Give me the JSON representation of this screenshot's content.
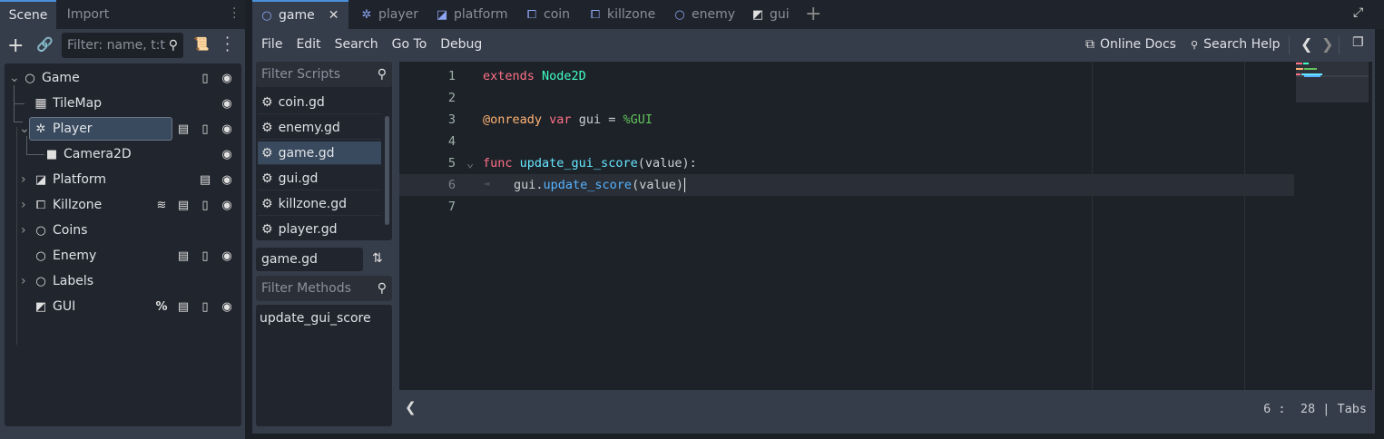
{
  "scene_dock": {
    "tabs": [
      "Scene",
      "Import"
    ],
    "filter_placeholder": "Filter: name, t:t",
    "tree": [
      {
        "name": "Game",
        "icon": "node2d-circle-icon"
      },
      {
        "name": "TileMap",
        "icon": "tilemap-icon"
      },
      {
        "name": "Player",
        "icon": "character-body-icon",
        "selected": true
      },
      {
        "name": "Camera2D",
        "icon": "camera-icon"
      },
      {
        "name": "Platform",
        "icon": "animatable-body-icon"
      },
      {
        "name": "Killzone",
        "icon": "area2d-icon"
      },
      {
        "name": "Coins",
        "icon": "node-circle-icon"
      },
      {
        "name": "Enemy",
        "icon": "node2d-circle-icon"
      },
      {
        "name": "Labels",
        "icon": "node-circle-icon"
      },
      {
        "name": "GUI",
        "icon": "canvas-layer-icon"
      }
    ]
  },
  "script_tabs": [
    "game",
    "player",
    "platform",
    "coin",
    "killzone",
    "enemy",
    "gui"
  ],
  "menu": [
    "File",
    "Edit",
    "Search",
    "Go To",
    "Debug"
  ],
  "toolbar": {
    "online_docs": "Online Docs",
    "search_help": "Search Help"
  },
  "scripts": {
    "filter_placeholder": "Filter Scripts",
    "items": [
      "coin.gd",
      "enemy.gd",
      "game.gd",
      "gui.gd",
      "killzone.gd",
      "player.gd"
    ],
    "selected": "game.gd",
    "current": "game.gd",
    "methods_placeholder": "Filter Methods",
    "methods": [
      "update_gui_score"
    ]
  },
  "editor": {
    "line_numbers": [
      "1",
      "2",
      "3",
      "4",
      "5",
      "6",
      "7"
    ],
    "tokens": {
      "l1a": "extends",
      "l1b": "Node2D",
      "l3a": "@onready",
      "l3b": "var",
      "l3c": "gui =",
      "l3d": "%GUI",
      "l5a": "func",
      "l5b": "update_gui_score",
      "l5c": "(value):",
      "l6a": "gui.",
      "l6b": "update_score",
      "l6c": "(value)"
    },
    "status": {
      "line": "6",
      "sep": ":",
      "col": "28",
      "indent": "Tabs"
    }
  },
  "colors": {
    "accent": "#4a8fd8",
    "selection": "#394a5e",
    "keyword": "#ff7085"
  }
}
